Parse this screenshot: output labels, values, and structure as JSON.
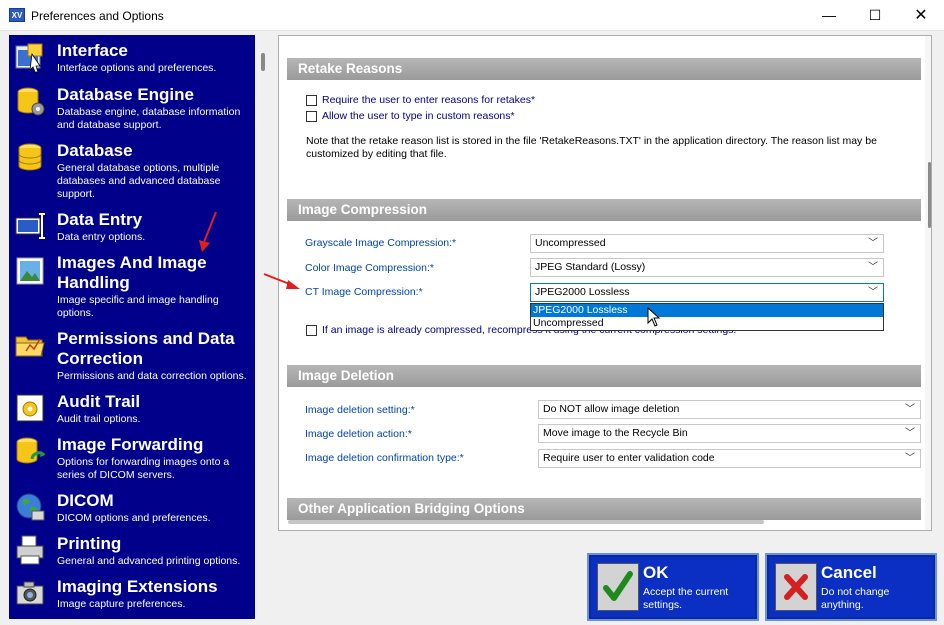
{
  "window": {
    "app_icon": "XV",
    "title": "Preferences and Options",
    "minimize_glyph": "—",
    "maximize_glyph": "☐",
    "close_glyph": "✕"
  },
  "sidebar": {
    "items": [
      {
        "icon": "interface-icon",
        "title": "Interface",
        "desc": "Interface options and preferences."
      },
      {
        "icon": "database-engine-icon",
        "title": "Database Engine",
        "desc": "Database engine, database information and database support."
      },
      {
        "icon": "database-icon",
        "title": "Database",
        "desc": "General database options, multiple databases and advanced database support."
      },
      {
        "icon": "data-entry-icon",
        "title": "Data Entry",
        "desc": "Data entry options."
      },
      {
        "icon": "images-icon",
        "title": "Images And Image Handling",
        "desc": "Image specific and image handling options."
      },
      {
        "icon": "permissions-folder-icon",
        "title": "Permissions and Data Correction",
        "desc": "Permissions and data correction options."
      },
      {
        "icon": "audit-trail-icon",
        "title": "Audit Trail",
        "desc": "Audit trail options."
      },
      {
        "icon": "image-forwarding-icon",
        "title": "Image Forwarding",
        "desc": "Options for forwarding images onto a series of DICOM servers."
      },
      {
        "icon": "dicom-globe-icon",
        "title": "DICOM",
        "desc": "DICOM options and preferences."
      },
      {
        "icon": "printer-icon",
        "title": "Printing",
        "desc": "General and advanced printing options."
      },
      {
        "icon": "camera-icon",
        "title": "Imaging Extensions",
        "desc": "Image capture preferences."
      }
    ]
  },
  "retake": {
    "header": "Retake Reasons",
    "require_label": "Require the user to enter reasons for retakes*",
    "allow_label": "Allow the user to type in custom reasons*",
    "note": "Note that the retake reason list is stored in the file 'RetakeReasons.TXT' in the application directory.  The reason list may be customized by editing that file."
  },
  "compression": {
    "header": "Image Compression",
    "grayscale_label": "Grayscale Image Compression:*",
    "grayscale_value": "Uncompressed",
    "color_label": "Color Image Compression:*",
    "color_value": "JPEG Standard (Lossy)",
    "ct_label": "CT Image Compression:*",
    "ct_value": "JPEG2000 Lossless",
    "ct_options": [
      "JPEG2000 Lossless",
      "Uncompressed"
    ],
    "recompress_label": "If an image is already compressed, recompress it using the current compression settings."
  },
  "deletion": {
    "header": "Image Deletion",
    "setting_label": "Image deletion setting:*",
    "setting_value": "Do NOT allow image deletion",
    "action_label": "Image deletion action:*",
    "action_value": "Move image to the Recycle Bin",
    "confirm_label": "Image deletion confirmation type:*",
    "confirm_value": "Require user to enter validation code"
  },
  "bridging": {
    "header": "Other Application Bridging Options"
  },
  "buttons": {
    "ok_title": "OK",
    "ok_desc": "Accept the current settings.",
    "cancel_title": "Cancel",
    "cancel_desc": "Do not change anything."
  },
  "colors": {
    "sidebar_bg": "#00008b",
    "section_header": "#a8a8a8",
    "button_bg": "#0a2fc2",
    "annotation_arrow": "#e02020"
  }
}
